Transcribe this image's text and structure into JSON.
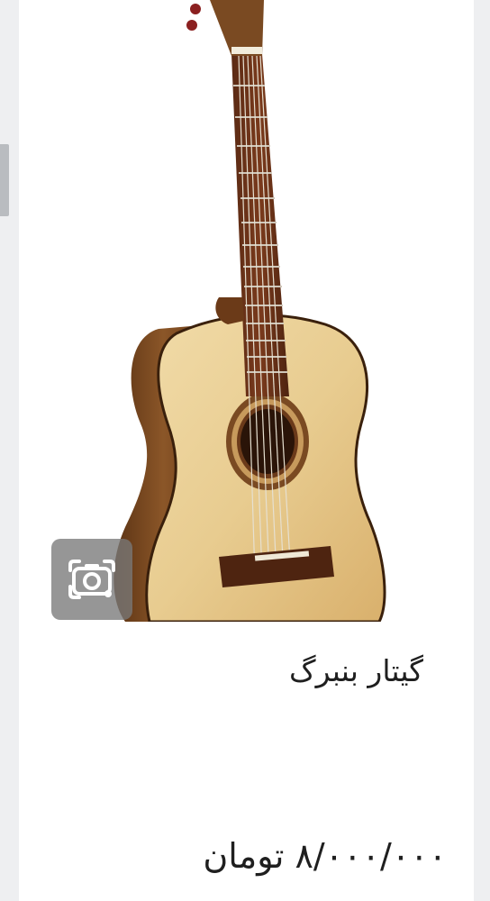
{
  "product": {
    "title": "گیتار بنبرگ",
    "price": "۸/۰۰۰/۰۰۰ تومان",
    "image_subject": "classical acoustic guitar"
  },
  "lens": {
    "icon": "camera-search-icon"
  },
  "colors": {
    "page_background": "#eeeff1",
    "card_background": "#ffffff",
    "text": "#1f1f1f",
    "lens_button": "#787878"
  }
}
